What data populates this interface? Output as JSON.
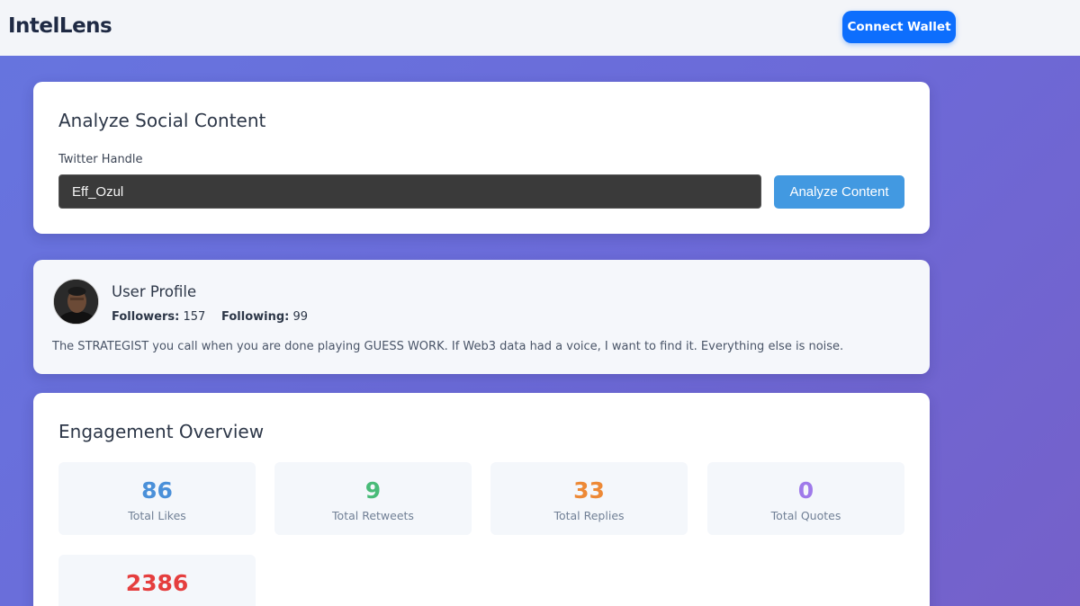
{
  "app": {
    "name": "IntelLens"
  },
  "header": {
    "connect_label": "Connect Wallet"
  },
  "analyze": {
    "title": "Analyze Social Content",
    "field_label": "Twitter Handle",
    "handle_value": "Eff_Ozul",
    "button_label": "Analyze Content"
  },
  "profile": {
    "title": "User Profile",
    "followers_label": "Followers:",
    "followers": "157",
    "following_label": "Following:",
    "following": "99",
    "bio": "The STRATEGIST you call when you are done playing GUESS WORK. If Web3 data had a voice, I want to find it. Everything else is noise."
  },
  "engagement": {
    "title": "Engagement Overview",
    "metrics": [
      {
        "value": "86",
        "label": "Total Likes",
        "color": "#4a90d9"
      },
      {
        "value": "9",
        "label": "Total Retweets",
        "color": "#48bb78"
      },
      {
        "value": "33",
        "label": "Total Replies",
        "color": "#ed8936"
      },
      {
        "value": "0",
        "label": "Total Quotes",
        "color": "#9f7aea"
      },
      {
        "value": "2386",
        "label": "",
        "color": "#e53e3e"
      }
    ]
  },
  "colors": {
    "accent": "#0d6efd",
    "analyze_button": "#4299e1",
    "background_gradient_start": "#6675df",
    "background_gradient_end": "#7560c9"
  }
}
